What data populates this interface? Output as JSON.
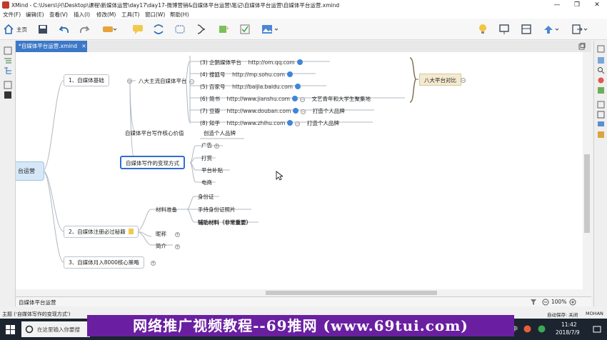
{
  "window": {
    "title": "XMind - C:\\Users\\兴\\Desktop\\课程\\新媒体运营\\day17\\day17-微博营销&自媒体平台运营\\笔记\\自媒体平台运营\\自媒体平台运营.xmind"
  },
  "menu": [
    "文件(F)",
    "编辑(E)",
    "查看(V)",
    "插入(I)",
    "修改(M)",
    "工具(T)",
    "窗口(W)",
    "帮助(H)"
  ],
  "toolbar": {
    "home_label": "主页"
  },
  "tab": {
    "label": "*自媒体平台运营.xmind",
    "close": "✕"
  },
  "mindmap": {
    "central_fragment": "台运营",
    "branch1": "1、自媒体基础",
    "branch1_sub": "八大主流自媒体平台",
    "platforms": [
      {
        "name": "(3)  企鹅媒体平台",
        "url": "http://om.qq.com",
        "note": ""
      },
      {
        "name": "(4)  搜狐号",
        "url": "http://mp.sohu.com",
        "note": ""
      },
      {
        "name": "(5)  百家号",
        "url": "http://baijia.baidu.com",
        "note": ""
      },
      {
        "name": "(6)  简书",
        "url": "http://www.jianshu.com",
        "note": "文艺青年和大学生聚集地"
      },
      {
        "name": "(7)  豆瓣",
        "url": "http://www.douban.com",
        "note": "打造个人品牌"
      },
      {
        "name": "(8)  知乎",
        "url": "http://www.zhihu.com",
        "note": "打造个人品牌"
      }
    ],
    "summary": "八大平台对比",
    "core_value": "自媒体平台写作核心价值",
    "core_value_child": "创造个人品牌",
    "monetize": "自媒体写作的变现方式",
    "monetize_children": [
      "广告",
      "打赏",
      "平台补贴",
      "电商"
    ],
    "branch2": "2、自媒体注册必过秘籍",
    "materials": "材料准备",
    "materials_children": [
      "身份证",
      "手持身份证照片",
      "辅助材料（非常重要）"
    ],
    "nickname": "昵称",
    "intro": "简介",
    "branch3": "3、自媒体月入8000核心策略"
  },
  "sheet": {
    "name": "自媒体平台运营",
    "zoom": "100%"
  },
  "status": {
    "left": "主题 ('自媒体写作的变现方式')",
    "autosave": "自动保存: 关闭",
    "user": "MOHAN"
  },
  "taskbar": {
    "search_placeholder": "在这里输入你要搜",
    "time": "11:42",
    "date": "2018/7/9",
    "ime": "中"
  },
  "watermark": "网络推广视频教程--69推网 (www.69tui.com)",
  "colors": {
    "accent": "#3c78c8",
    "selected_border": "#2e6fd1",
    "summary_fill": "#f3ead0",
    "central_fill": "#d6e8f7",
    "banner": "#6a1fa1"
  }
}
